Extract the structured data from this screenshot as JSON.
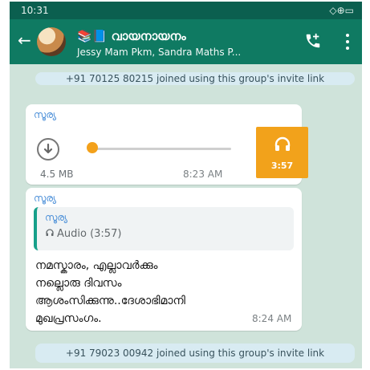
{
  "status_bar": {
    "time": "10:31",
    "icons_text": "◇⊕▭"
  },
  "header": {
    "back_icon": "←",
    "group_title": "📚📘 വായനായനം",
    "members_line": "Jessy Mam Pkm, Sandra Maths P..."
  },
  "system_messages": {
    "top": "+91 70125 80215 joined using this group's invite link",
    "bottom": "+91 79023 00942 joined using this group's invite link"
  },
  "voice_message": {
    "sender": "സൂര്യ",
    "size": "4.5 MB",
    "time": "8:23 AM",
    "duration": "3:57",
    "progress": 0
  },
  "reply_message": {
    "sender": "സൂര്യ",
    "quoted_sender": "സൂര്യ",
    "quoted_audio": "Audio (3:57)",
    "text": "നമസ്കാരം, എല്ലാവർക്കും\nനല്ലൊരു ദിവസം\nആശംസിക്കുന്നു..ദേശാഭിമാനി\nമുഖപ്രസംഗം.",
    "time": "8:24 AM"
  },
  "icons": {
    "call": "add-call-icon",
    "menu": "more-vert-icon",
    "download": "download-icon",
    "headphones": "headphones-icon"
  },
  "colors": {
    "app_bar": "#0f7a62",
    "status_bar": "#0b5f4f",
    "chat_bg": "#cfe3da",
    "accent_audio": "#f2a21b",
    "sender_name": "#4b8fd8"
  }
}
